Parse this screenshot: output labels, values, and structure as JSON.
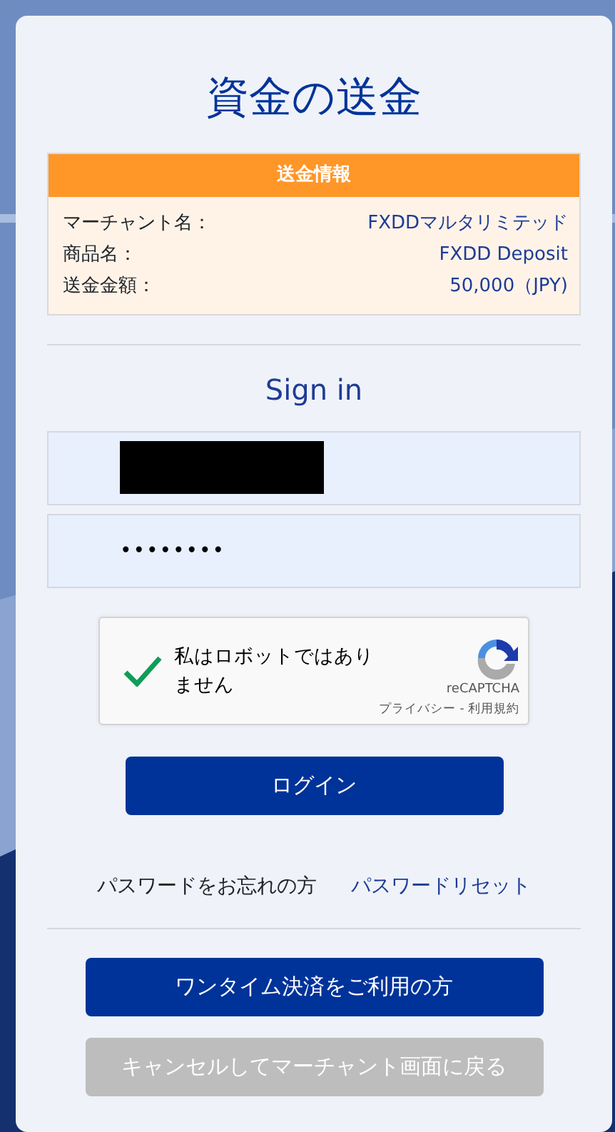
{
  "title": "資金の送金",
  "transfer_info": {
    "header": "送金情報",
    "rows": [
      {
        "label": "マーチャント名：",
        "value": "FXDDマルタリミテッド"
      },
      {
        "label": "商品名：",
        "value": "FXDD Deposit"
      },
      {
        "label": "送金金額：",
        "value": "50,000（JPY)"
      }
    ]
  },
  "sign_in": {
    "heading": "Sign in",
    "username": {
      "redacted": true
    },
    "password": {
      "value": "••••••••"
    }
  },
  "captcha": {
    "label": "私はロボットではありません",
    "checked": true,
    "brand": "reCAPTCHA",
    "privacy": "プライバシー",
    "separator": " - ",
    "terms": "利用規約"
  },
  "login_button": "ログイン",
  "forgot": {
    "text": "パスワードをお忘れの方",
    "link": "パスワードリセット"
  },
  "buttons": [
    {
      "label": "ワンタイム決済をご利用の方",
      "disabled": false
    },
    {
      "label": "キャンセルしてマーチャント画面に戻る",
      "disabled": true
    }
  ]
}
